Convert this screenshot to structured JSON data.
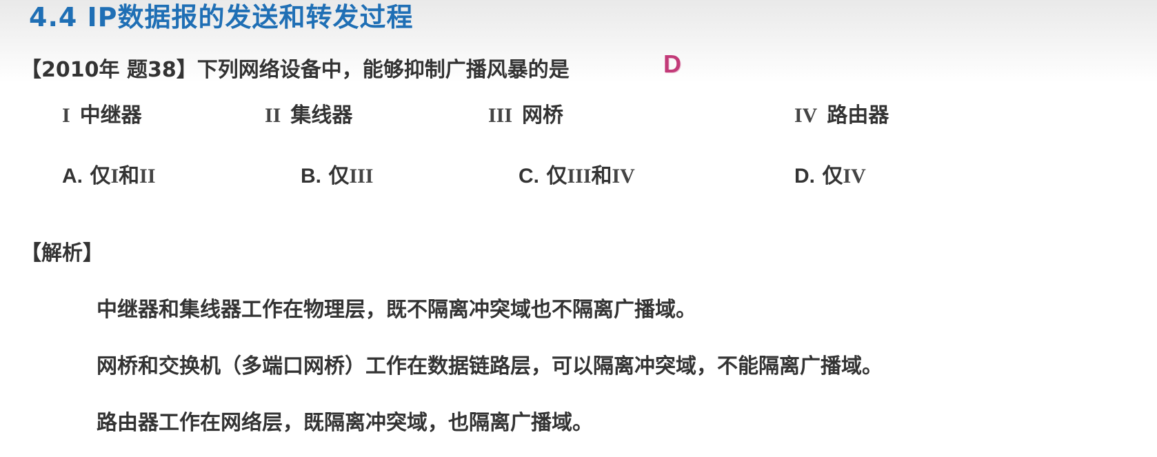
{
  "title": "4.4  IP数据报的发送和转发过程",
  "question": {
    "text": "【2010年 题38】下列网络设备中，能够抑制广播风暴的是",
    "answer": "D"
  },
  "devices": [
    {
      "roman": "I",
      "label": "中继器"
    },
    {
      "roman": "II",
      "label": "集线器"
    },
    {
      "roman": "III",
      "label": "网桥"
    },
    {
      "roman": "IV",
      "label": "路由器"
    }
  ],
  "options": [
    {
      "letter": "A.",
      "prefix": "仅",
      "parts": [
        "I",
        "和",
        "II"
      ]
    },
    {
      "letter": "B.",
      "prefix": "仅",
      "parts": [
        "III"
      ]
    },
    {
      "letter": "C.",
      "prefix": "仅",
      "parts": [
        "III",
        "和",
        "IV"
      ]
    },
    {
      "letter": "D.",
      "prefix": "仅",
      "parts": [
        "IV"
      ]
    }
  ],
  "analysis": {
    "heading": "【解析】",
    "lines": [
      "中继器和集线器工作在物理层，既不隔离冲突域也不隔离广播域。",
      "网桥和交换机（多端口网桥）工作在数据链路层，可以隔离冲突域，不能隔离广播域。",
      "路由器工作在网络层，既隔离冲突域，也隔离广播域。"
    ]
  }
}
